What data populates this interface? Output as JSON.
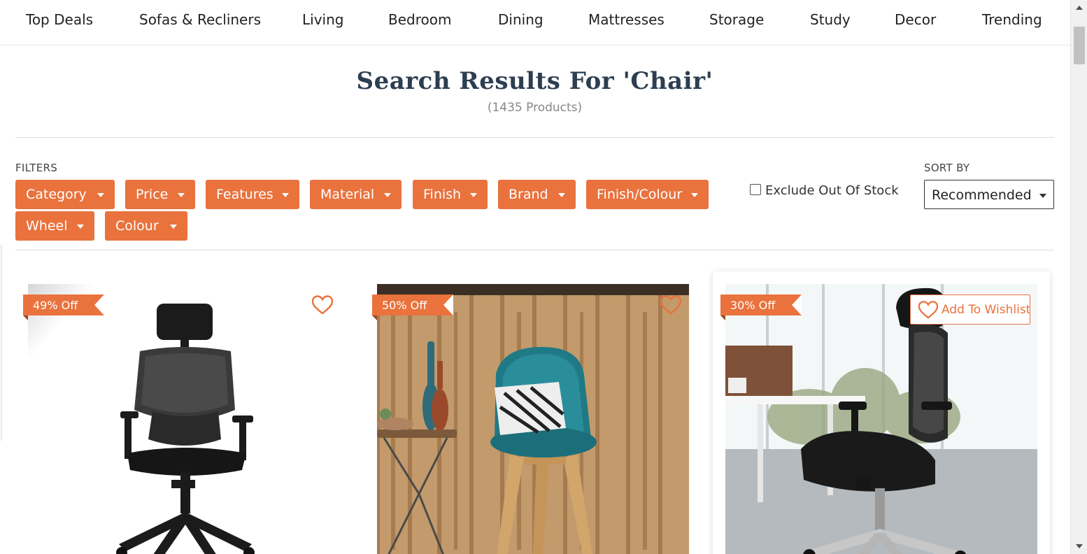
{
  "nav": {
    "items": [
      "Top Deals",
      "Sofas & Recliners",
      "Living",
      "Bedroom",
      "Dining",
      "Mattresses",
      "Storage",
      "Study",
      "Decor",
      "Trending"
    ]
  },
  "search": {
    "title": "Search Results For 'Chair'",
    "count": "(1435 Products)"
  },
  "filters": {
    "label": "FILTERS",
    "chips": [
      "Category",
      "Price",
      "Features",
      "Material",
      "Finish",
      "Brand",
      "Finish/Colour",
      "Wheel",
      "Colour"
    ],
    "exclude_out_of_stock": "Exclude Out Of Stock"
  },
  "sort": {
    "label": "SORT BY",
    "selected": "Recommended"
  },
  "products": [
    {
      "discount": "49% Off",
      "image": "black mesh office chair with headrest"
    },
    {
      "discount": "50% Off",
      "image": "teal shell chair with wooden legs and cushion"
    },
    {
      "discount": "30% Off",
      "image": "black ergonomic office chair in bright office",
      "wishlist_label": "Add To Wishlist"
    }
  ],
  "colors": {
    "accent": "#e9723d",
    "title": "#2c3e50"
  }
}
